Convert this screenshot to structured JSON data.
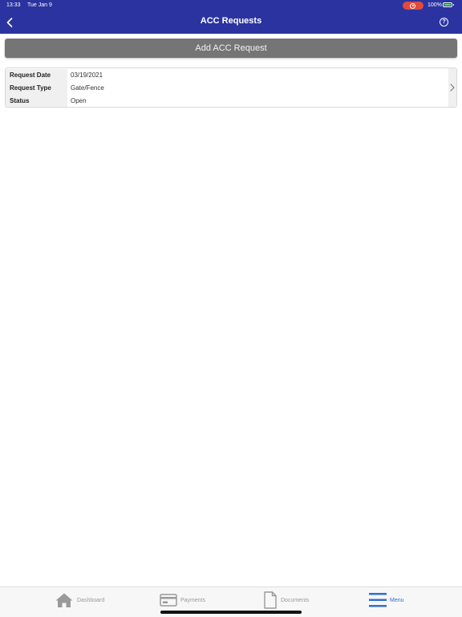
{
  "status_bar": {
    "time": "13:33",
    "date": "Tue Jan 9",
    "battery_pct": "100%"
  },
  "header": {
    "title": "ACC Requests"
  },
  "actions": {
    "add_label": "Add ACC Request"
  },
  "request": {
    "rows": [
      {
        "label": "Request Date",
        "value": "03/19/2021"
      },
      {
        "label": "Request Type",
        "value": "Gate/Fence"
      },
      {
        "label": "Status",
        "value": "Open"
      }
    ]
  },
  "tabs": [
    {
      "label": "Dashboard",
      "icon": "home-icon"
    },
    {
      "label": "Payments",
      "icon": "card-icon"
    },
    {
      "label": "Documents",
      "icon": "document-icon"
    },
    {
      "label": "Menu",
      "icon": "menu-icon"
    }
  ],
  "colors": {
    "header_bg": "#2b33a0",
    "button_bg": "#757575",
    "active_tab": "#2f6fd3",
    "inactive_tab": "#9a9a9a"
  }
}
